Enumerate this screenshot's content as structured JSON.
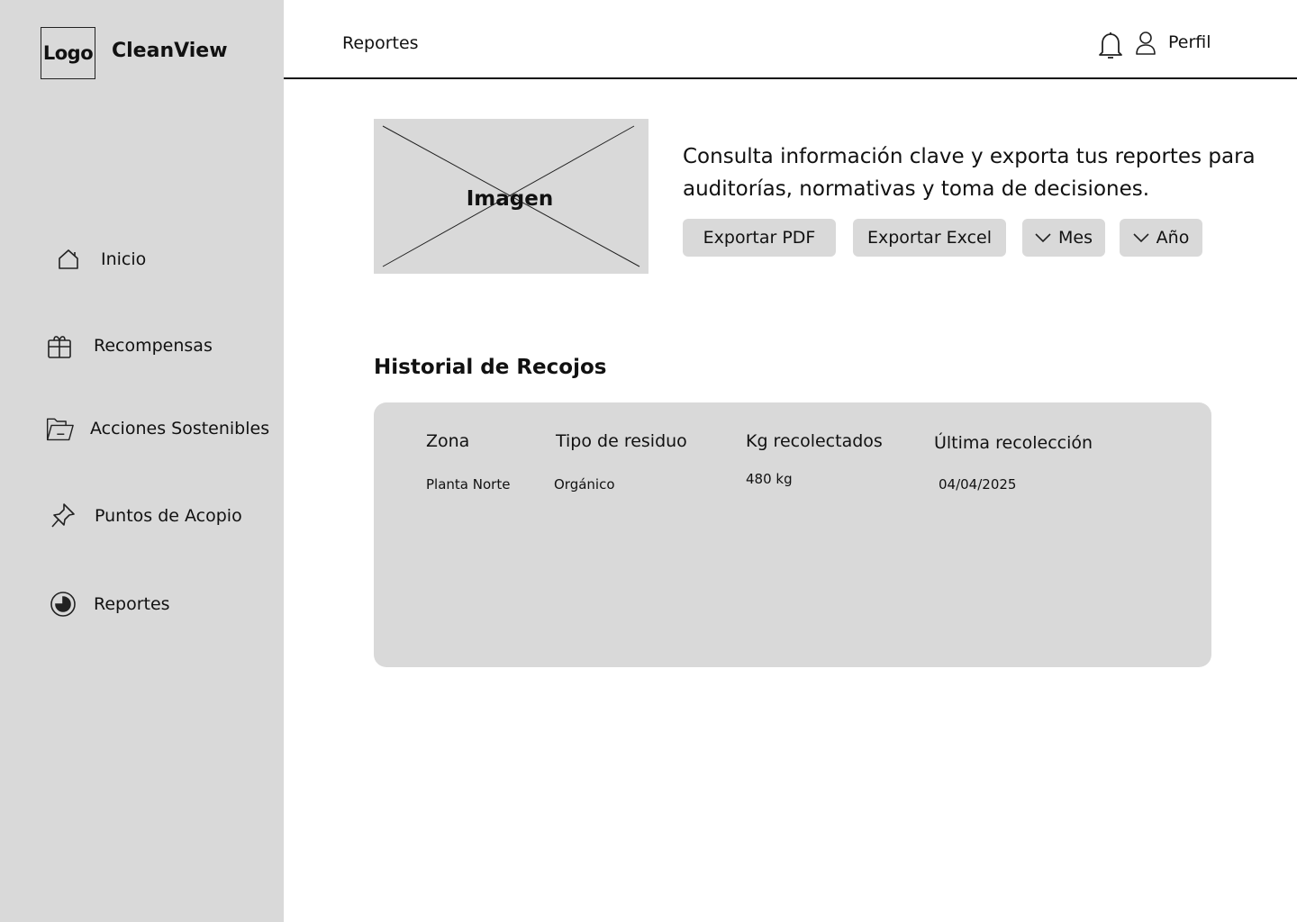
{
  "sidebar": {
    "logo": "Logo",
    "brand": "CleanView",
    "items": [
      {
        "label": "Inicio",
        "icon": "home-icon"
      },
      {
        "label": "Recompensas",
        "icon": "gift-icon"
      },
      {
        "label": "Acciones Sostenibles",
        "icon": "folder-open-icon"
      },
      {
        "label": "Puntos de Acopio",
        "icon": "pin-icon"
      },
      {
        "label": "Reportes",
        "icon": "pie-chart-icon"
      }
    ]
  },
  "header": {
    "title": "Reportes",
    "profile_label": "Perfil",
    "icons": [
      "bell-icon",
      "user-icon"
    ]
  },
  "hero": {
    "image_label": "Imagen",
    "description": "Consulta información clave y exporta tus reportes para auditorías, normativas y toma de decisiones.",
    "buttons": {
      "export_pdf": "Exportar PDF",
      "export_excel": "Exportar Excel",
      "month": "Mes",
      "year": "Año"
    }
  },
  "history": {
    "title": "Historial de Recojos",
    "columns": [
      "Zona",
      "Tipo de residuo",
      "Kg recolectados",
      "Última recolección"
    ],
    "rows": [
      [
        "Planta Norte",
        "Orgánico",
        "480 kg",
        "04/04/2025"
      ]
    ]
  },
  "colors": {
    "panel_gray": "#d9d9d9",
    "text": "#111111",
    "background": "#ffffff"
  }
}
